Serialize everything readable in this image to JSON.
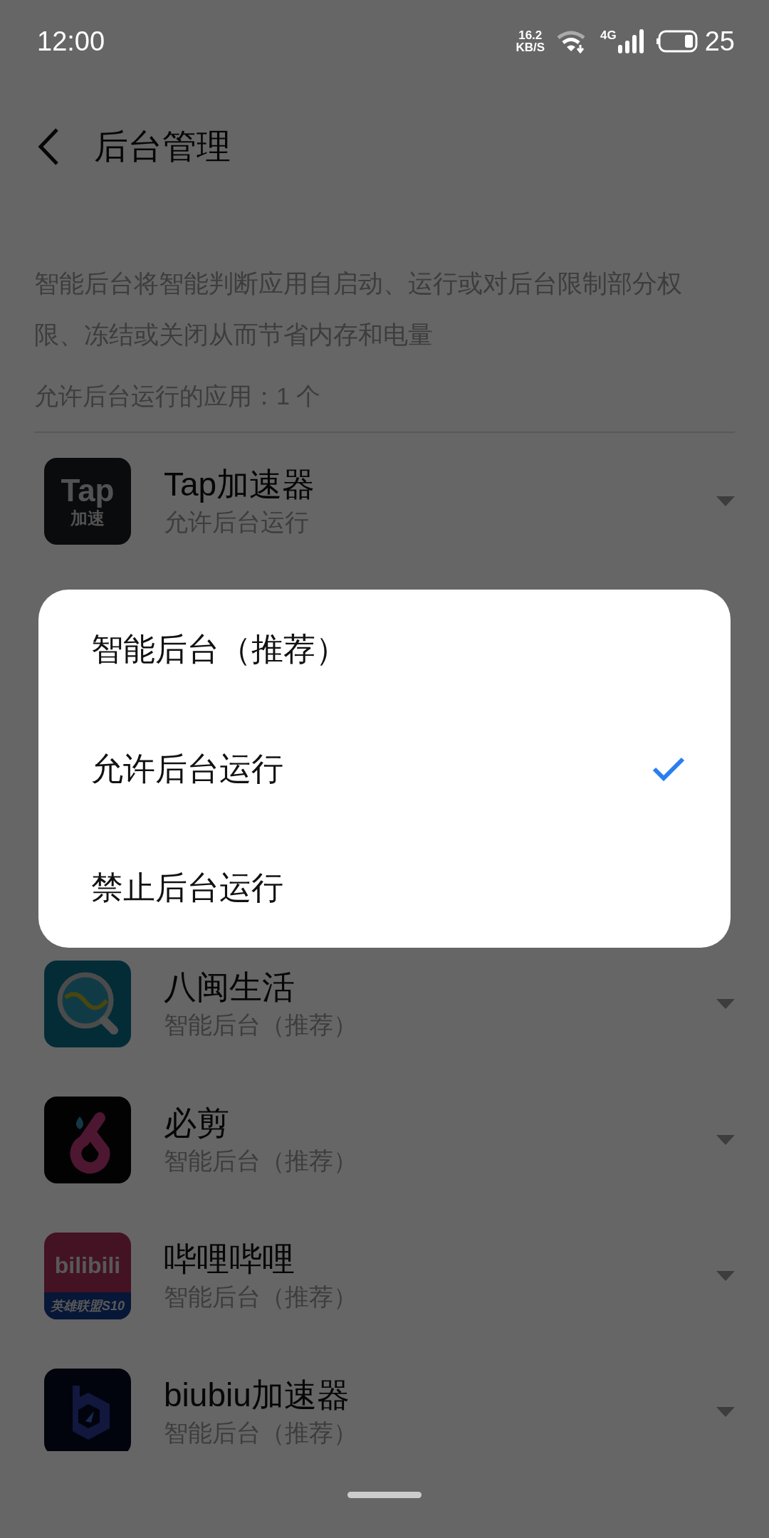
{
  "status_bar": {
    "time": "12:00",
    "speed_value": "16.2",
    "speed_unit": "KB/S",
    "network": "4G",
    "battery": "25"
  },
  "header": {
    "title": "后台管理"
  },
  "description": "智能后台将智能判断应用自启动、运行或对后台限制部分权限、冻结或关闭从而节省内存和电量",
  "allowed_count": "允许后台运行的应用：1 个",
  "apps_above_dialog": [
    {
      "name": "Tap加速器",
      "mode": "允许后台运行",
      "icon": {
        "kind": "tap",
        "texts": [
          "Tap",
          "加速"
        ]
      }
    }
  ],
  "apps_below_dialog": [
    {
      "name": "八闽生活",
      "mode": "智能后台（推荐）",
      "icon": {
        "kind": "magnifier"
      }
    },
    {
      "name": "必剪",
      "mode": "智能后台（推荐）",
      "icon": {
        "kind": "loop"
      }
    },
    {
      "name": "哔哩哔哩",
      "mode": "智能后台（推荐）",
      "icon": {
        "kind": "banner",
        "texts": [
          "bilibili",
          "英雄联盟S10"
        ]
      }
    },
    {
      "name": "biubiu加速器",
      "mode": "智能后台（推荐）",
      "icon": {
        "kind": "hexagon"
      }
    }
  ],
  "dialog": {
    "options": [
      {
        "label": "智能后台（推荐）",
        "selected": false
      },
      {
        "label": "允许后台运行",
        "selected": true
      },
      {
        "label": "禁止后台运行",
        "selected": false
      }
    ]
  }
}
